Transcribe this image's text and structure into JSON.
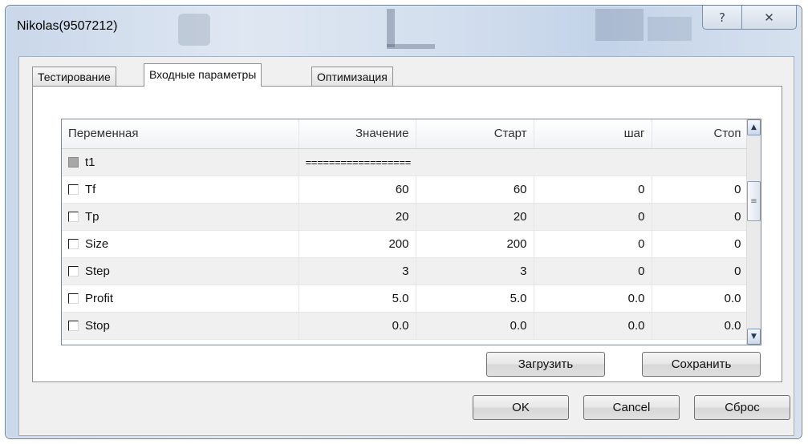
{
  "window": {
    "title": "Nikolas(9507212)",
    "help_glyph": "?",
    "close_glyph": "✕"
  },
  "tabs": [
    {
      "label": "Тестирование",
      "active": false
    },
    {
      "label": "Входные параметры",
      "active": true
    },
    {
      "label": "Оптимизация",
      "active": false
    }
  ],
  "table": {
    "columns": [
      "Переменная",
      "Значение",
      "Старт",
      "шаг",
      "Стоп"
    ],
    "rows": [
      {
        "checked": false,
        "disabled": true,
        "name": "t1",
        "value": "==================",
        "start": "",
        "step": "",
        "stop": ""
      },
      {
        "checked": false,
        "disabled": false,
        "name": "Tf",
        "value": "60",
        "start": "60",
        "step": "0",
        "stop": "0"
      },
      {
        "checked": false,
        "disabled": false,
        "name": "Tp",
        "value": "20",
        "start": "20",
        "step": "0",
        "stop": "0"
      },
      {
        "checked": false,
        "disabled": false,
        "name": "Size",
        "value": "200",
        "start": "200",
        "step": "0",
        "stop": "0"
      },
      {
        "checked": false,
        "disabled": false,
        "name": "Step",
        "value": "3",
        "start": "3",
        "step": "0",
        "stop": "0"
      },
      {
        "checked": false,
        "disabled": false,
        "name": "Profit",
        "value": "5.0",
        "start": "5.0",
        "step": "0.0",
        "stop": "0.0"
      },
      {
        "checked": false,
        "disabled": false,
        "name": "Stop",
        "value": "0.0",
        "start": "0.0",
        "step": "0.0",
        "stop": "0.0"
      }
    ],
    "scroll_fraction": 0.3
  },
  "buttons": {
    "load": "Загрузить",
    "save": "Сохранить",
    "ok": "OK",
    "cancel": "Cancel",
    "reset": "Сброс"
  }
}
